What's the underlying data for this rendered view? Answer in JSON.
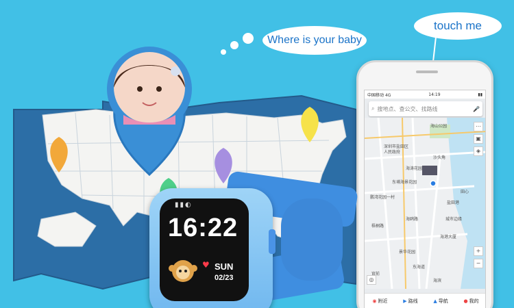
{
  "bubbles": {
    "where_baby": "Where is your baby",
    "touch_me": "touch me"
  },
  "phone": {
    "status": {
      "carrier": "中国移动",
      "network": "4G",
      "time": "14:19"
    },
    "search": {
      "placeholder": "搜地点、查公交、找路线"
    },
    "map_labels": [
      "海山公园",
      "深圳市盐田区",
      "人民政府",
      "海涛花园",
      "沙头角",
      "东埔海景花园",
      "田心",
      "鹏湾花园一村",
      "盐田港",
      "城市边缘",
      "景华花园",
      "海港大厦",
      "梧桐路",
      "海鸥路",
      "东海道",
      "官前",
      "海滨"
    ],
    "bottom_nav": [
      "附近",
      "路线",
      "导航",
      "我的"
    ]
  },
  "watch": {
    "status_icons": "▮▮◐",
    "time": "16:22",
    "day": "SUN",
    "date": "02/23"
  },
  "colors": {
    "background": "#41c0e6",
    "map": "#f4f4f2",
    "map_border": "#2c6ea6",
    "strap": "#3f8ee0",
    "bubble_text": "#1a73c8"
  }
}
